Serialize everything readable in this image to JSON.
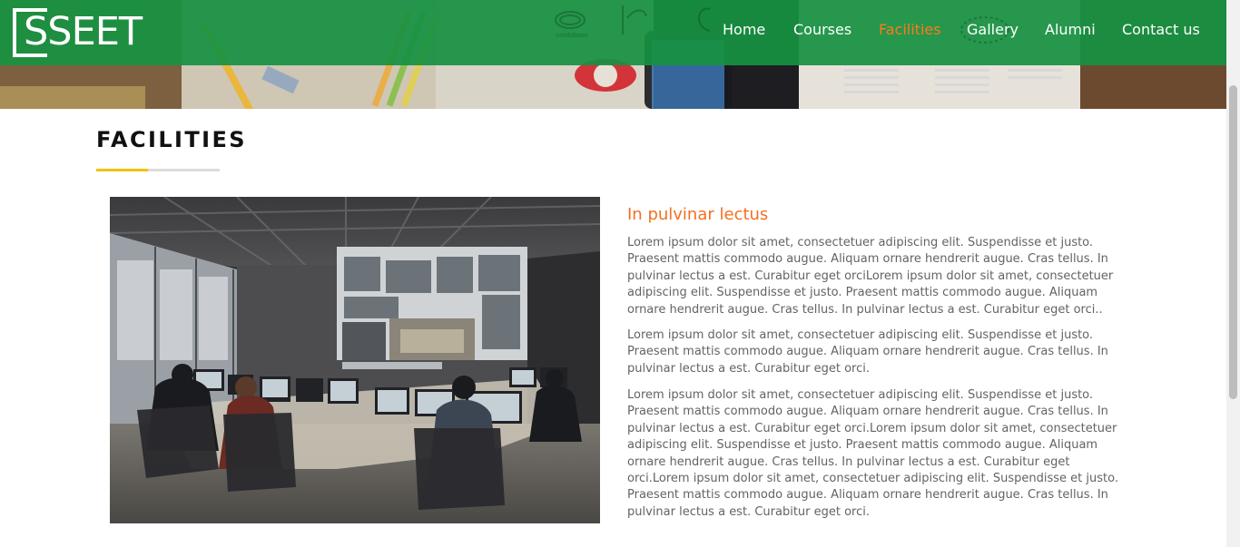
{
  "brand": {
    "logo_text": "SSEET"
  },
  "nav": {
    "items": [
      {
        "label": "Home"
      },
      {
        "label": "Courses"
      },
      {
        "label": "Facilities",
        "active": true
      },
      {
        "label": "Gallery"
      },
      {
        "label": "Alumni"
      },
      {
        "label": "Contact us"
      }
    ]
  },
  "page": {
    "title": "FACILITIES"
  },
  "facility": {
    "heading": "In pulvinar lectus",
    "paragraphs": [
      "Lorem ipsum dolor sit amet, consectetuer adipiscing elit. Suspendisse et justo. Praesent mattis commodo augue. Aliquam ornare hendrerit augue. Cras tellus. In pulvinar lectus a est. Curabitur eget orciLorem ipsum dolor sit amet, consectetuer adipiscing elit. Suspendisse et justo. Praesent mattis commodo augue. Aliquam ornare hendrerit augue. Cras tellus. In pulvinar lectus a est. Curabitur eget orci..",
      "Lorem ipsum dolor sit amet, consectetuer adipiscing elit. Suspendisse et justo. Praesent mattis commodo augue. Aliquam ornare hendrerit augue. Cras tellus. In pulvinar lectus a est. Curabitur eget orci.",
      "Lorem ipsum dolor sit amet, consectetuer adipiscing elit. Suspendisse et justo. Praesent mattis commodo augue. Aliquam ornare hendrerit augue. Cras tellus. In pulvinar lectus a est. Curabitur eget orci.Lorem ipsum dolor sit amet, consectetuer adipiscing elit. Suspendisse et justo. Praesent mattis commodo augue. Aliquam ornare hendrerit augue. Cras tellus. In pulvinar lectus a est. Curabitur eget orci.Lorem ipsum dolor sit amet, consectetuer adipiscing elit. Suspendisse et justo. Praesent mattis commodo augue. Aliquam ornare hendrerit augue. Cras tellus. In pulvinar lectus a est. Curabitur eget orci."
    ]
  },
  "colors": {
    "navbar": "#179142",
    "active_nav": "#ff7a1a",
    "subheading": "#f27022",
    "title_accent": "#f2c200",
    "body_text": "#636363"
  },
  "hero_logos": {
    "conedison": "conEdison",
    "lg": "LG"
  }
}
